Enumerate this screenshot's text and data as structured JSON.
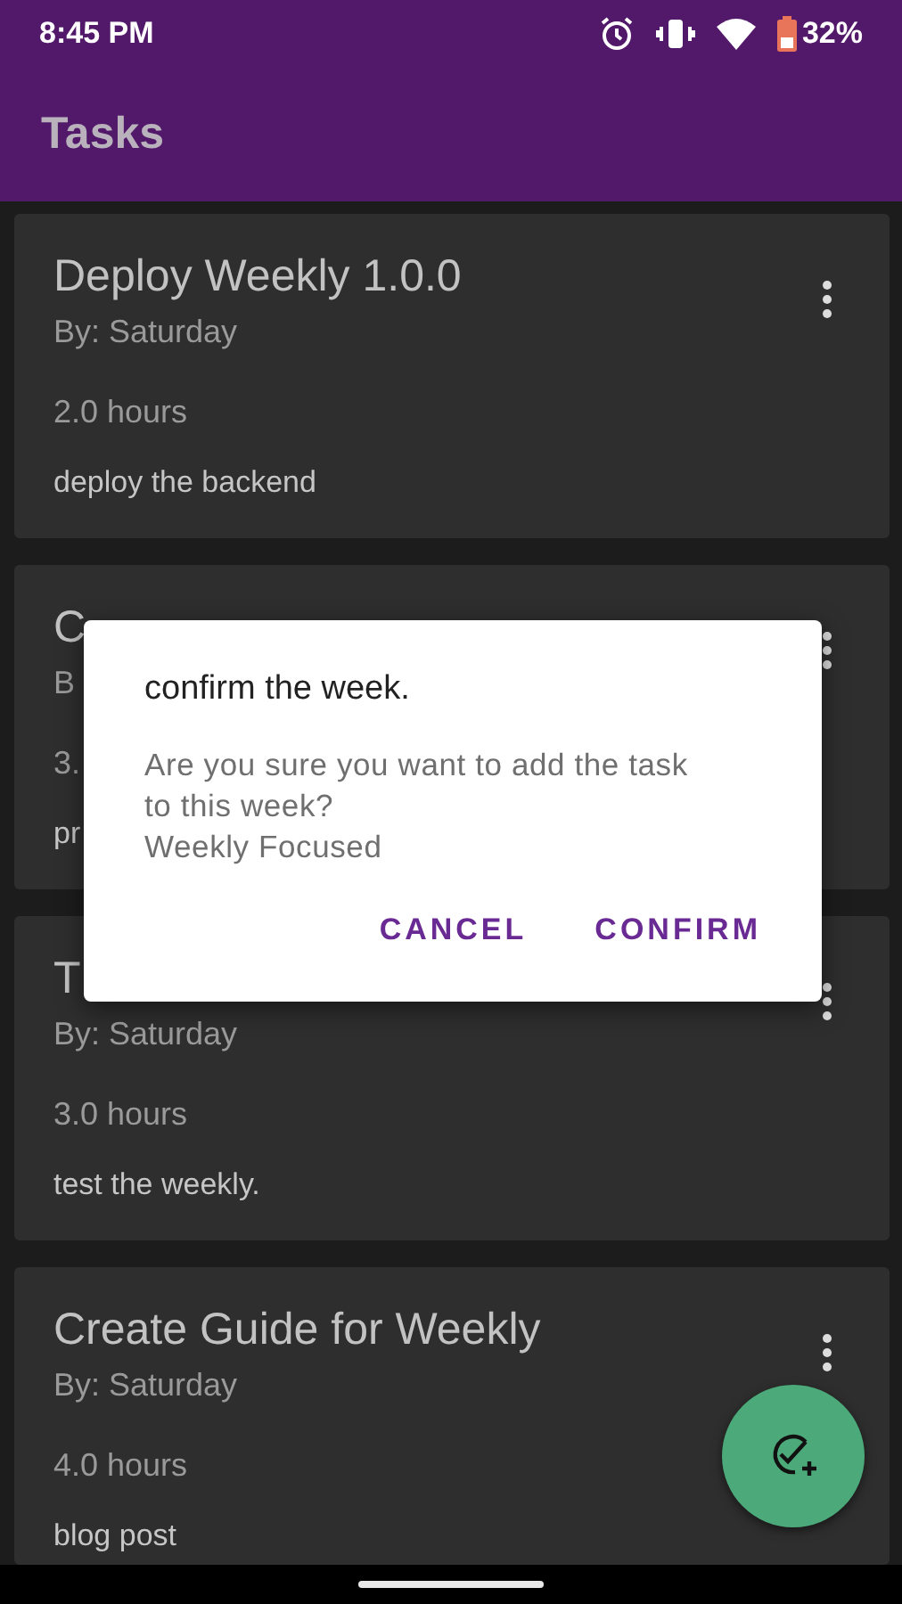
{
  "status_bar": {
    "time": "8:45 PM",
    "battery": "32%"
  },
  "app_bar": {
    "title": "Tasks"
  },
  "tasks": [
    {
      "title": "Deploy Weekly 1.0.0",
      "by": "By: Saturday",
      "hours": "2.0 hours",
      "description": "deploy the backend"
    },
    {
      "title": "C",
      "by": "B",
      "hours": "3.",
      "description": "pr"
    },
    {
      "title": "T",
      "by": "By: Saturday",
      "hours": "3.0 hours",
      "description": "test the weekly."
    },
    {
      "title": "Create Guide for Weekly",
      "by": "By: Saturday",
      "hours": "4.0 hours",
      "description": "blog post"
    }
  ],
  "dialog": {
    "title": "confirm the week.",
    "message": "Are you sure you want to add the task to this week?\nWeekly Focused",
    "buttons": [
      "CANCEL",
      "CONFIRM"
    ]
  }
}
